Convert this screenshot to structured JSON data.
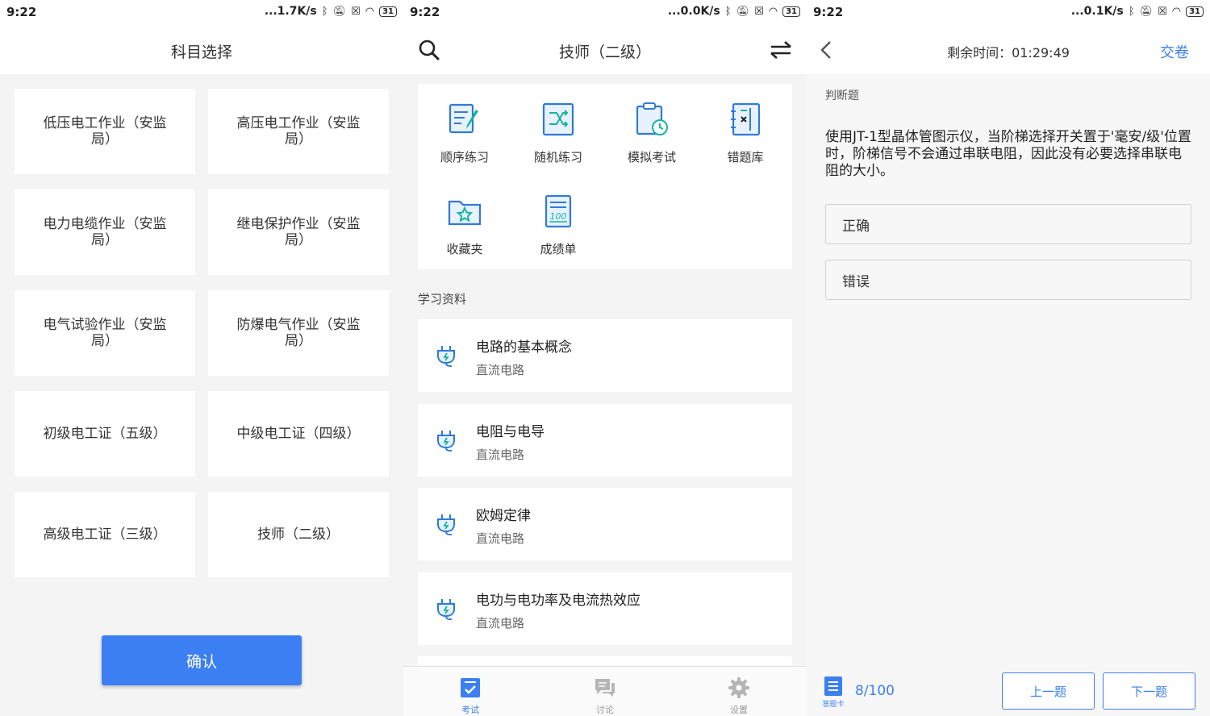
{
  "colors": {
    "accent": "#3b7ff2",
    "tool_icon": "#2f7ad8",
    "teal": "#15b3a3"
  },
  "statusbar": {
    "time": "9:22",
    "speeds": [
      "...1.7K/s",
      "...0.0K/s",
      "...0.1K/s"
    ],
    "battery": "31"
  },
  "subject_select": {
    "title": "科目选择",
    "subjects": [
      "低压电工作业（安监局）",
      "高压电工作业（安监局）",
      "电力电缆作业（安监局）",
      "继电保护作业（安监局）",
      "电气试验作业（安监局）",
      "防爆电气作业（安监局）",
      "初级电工证（五级）",
      "中级电工证（四级）",
      "高级电工证（三级）",
      "技师（二级）"
    ],
    "confirm_label": "确认"
  },
  "home": {
    "title": "技师（二级）",
    "tools": [
      {
        "label": "顺序练习",
        "icon": "pencil-doc-icon"
      },
      {
        "label": "随机练习",
        "icon": "shuffle-icon"
      },
      {
        "label": "模拟考试",
        "icon": "clipboard-clock-icon"
      },
      {
        "label": "错题库",
        "icon": "wrong-book-icon"
      },
      {
        "label": "收藏夹",
        "icon": "star-folder-icon"
      },
      {
        "label": "成绩单",
        "icon": "score-sheet-icon"
      }
    ],
    "section_label": "学习资料",
    "materials": [
      {
        "title": "电路的基本概念",
        "subtitle": "直流电路"
      },
      {
        "title": "电阻与电导",
        "subtitle": "直流电路"
      },
      {
        "title": "欧姆定律",
        "subtitle": "直流电路"
      },
      {
        "title": "电功与电功率及电流热效应",
        "subtitle": "直流电路"
      }
    ],
    "tabs": [
      {
        "label": "考试",
        "active": true
      },
      {
        "label": "讨论",
        "active": false
      },
      {
        "label": "设置",
        "active": false
      }
    ]
  },
  "quiz": {
    "timer": "剩余时间：01:29:49",
    "submit_label": "交卷",
    "question_type": "判断题",
    "question": "使用JT-1型晶体管图示仪，当阶梯选择开关置于'毫安/级'位置时，阶梯信号不会通过串联电阻，因此没有必要选择串联电阻的大小。",
    "options": [
      "正确",
      "错误"
    ],
    "answer_card_label": "答题卡",
    "progress": "8/100",
    "prev_label": "上一题",
    "next_label": "下一题"
  }
}
